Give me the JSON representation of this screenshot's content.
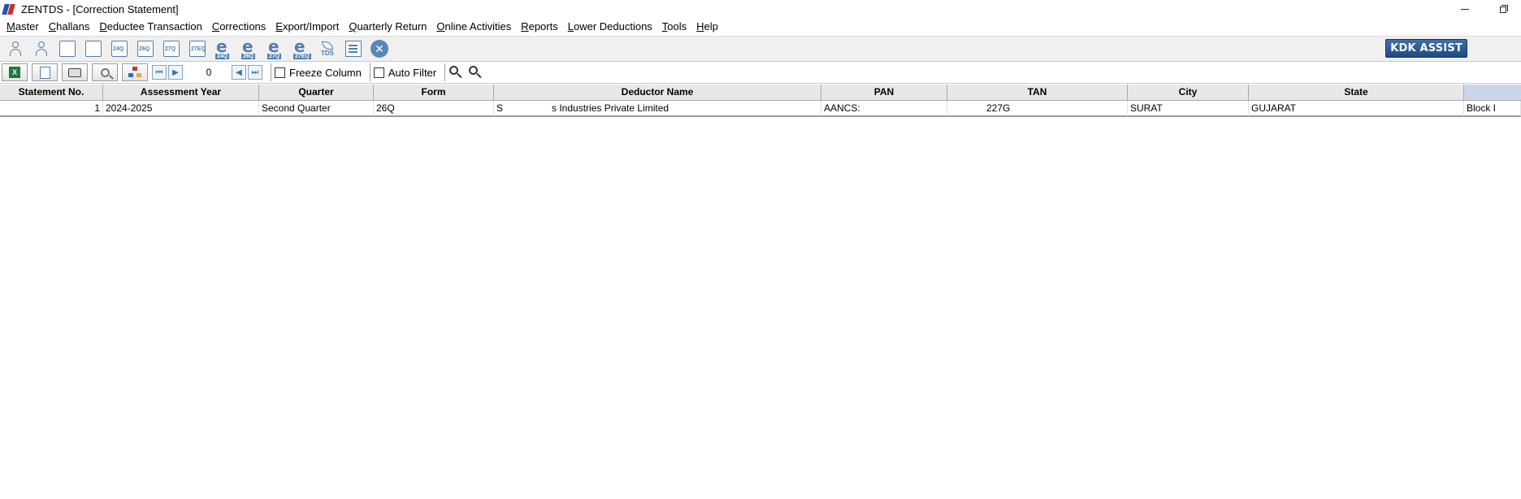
{
  "window": {
    "title": "ZENTDS - [Correction Statement]"
  },
  "menu": {
    "items": [
      "Master",
      "Challans",
      "Deductee Transaction",
      "Corrections",
      "Export/Import",
      "Quarterly Return",
      "Online Activities",
      "Reports",
      "Lower Deductions",
      "Tools",
      "Help"
    ]
  },
  "toolbar": {
    "icons": {
      "f24q": "24Q",
      "f26q": "26Q",
      "f27q": "27Q",
      "f27eq": "27EQ",
      "tds": "TDS"
    },
    "kdk_assist": "KDK ASSIST",
    "close_glyph": "✕"
  },
  "toolbar2": {
    "excel_glyph": "X",
    "record_number": "0",
    "freeze_column": "Freeze Column",
    "auto_filter": "Auto Filter"
  },
  "grid": {
    "headers": {
      "stmt": "Statement No.",
      "ay": "Assessment Year",
      "qtr": "Quarter",
      "form": "Form",
      "ded": "Deductor Name",
      "pan": "PAN",
      "tan": "TAN",
      "city": "City",
      "state": "State",
      "last": ""
    },
    "rows": [
      {
        "stmt": "1",
        "ay": "2024-2025",
        "qtr": "Second Quarter",
        "form": "26Q",
        "ded": "S                  s Industries Private Limited",
        "pan": "AANCS:",
        "tan": "227G",
        "city": "SURAT",
        "state": "GUJARAT",
        "last": "Block I"
      }
    ]
  }
}
